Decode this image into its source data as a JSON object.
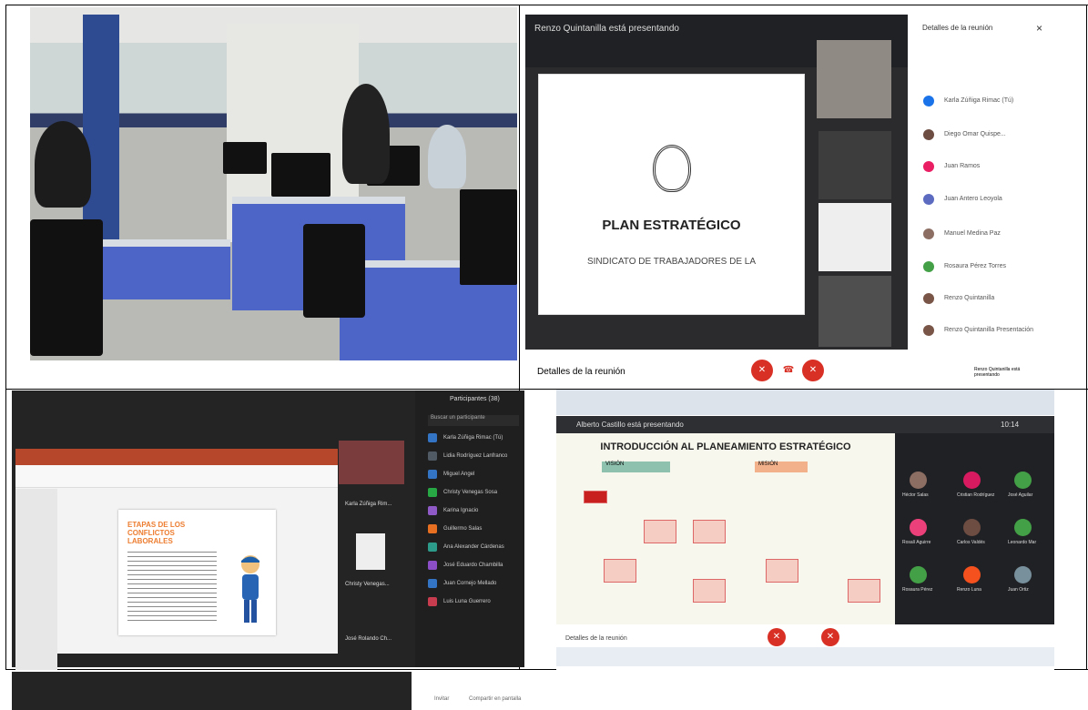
{
  "meeting_top": {
    "presenter_text": "Renzo Quintanilla está presentando"
  },
  "slide": {
    "title": "PLAN ESTRATÉGICO",
    "subtitle": "SINDICATO DE TRABAJADORES DE LA"
  },
  "meet_details": {
    "title": "Detalles de la reunión",
    "people": [
      "Karla Zúñiga Rimac (Tú)",
      "Diego Omar Quispe...",
      "Juan Ramos",
      "Juan Antero Leoyola",
      "Manuel Medina Paz",
      "Rosaura Pérez Torres",
      "Renzo Quintanilla",
      "Renzo Quintanilla Presentación"
    ]
  },
  "meet_controls": {
    "details": "Detalles de la reunión",
    "presenter_label": "Renzo Quintanilla está presentando"
  },
  "zoom": {
    "participants_title": "Participantes (38)",
    "search_placeholder": "Buscar un participante",
    "slide_title": "Etapas de los conflictos laborales",
    "tiles": [
      "Karla Zúñiga Rim...",
      "Christy Venegas...",
      "José Rolando Ch..."
    ],
    "participants": [
      "Karla Zúñiga Rimac (Tú)",
      "Lidia Rodríguez Lanfranco",
      "Miguel Angel",
      "Christy Venegas Sosa",
      "Karina Ignacio",
      "Guillermo Salas",
      "Ana Alexander Cárdenas",
      "José Eduardo Chambilla",
      "Juan Cornejo Mellado",
      "Luis Luna Guerrero"
    ]
  },
  "browser": {
    "presenter_text": "Alberto Castillo está presentando",
    "slide_title": "INTRODUCCIÓN AL PLANEAMIENTO ESTRATÉGICO",
    "vision_label": "VISIÓN",
    "mision_label": "MISIÓN",
    "details": "Detalles de la reunión",
    "time": "10:14",
    "gallery": [
      "Héctor Salas",
      "Cristian Rodríguez",
      "José Aguilar",
      "Rosalí Aguirre",
      "Carlos Valdés",
      "Leonardo Mar",
      "Rosaura Pérez",
      "Renzo Luna",
      "Juan Ortiz"
    ]
  },
  "bottom": {
    "left_link": "Invitar",
    "right_link": "Compartir en pantalla"
  },
  "colors": {
    "meet_red": "#d93025",
    "ppt_orange": "#b7472a",
    "room_blue": "#4d65c7"
  }
}
